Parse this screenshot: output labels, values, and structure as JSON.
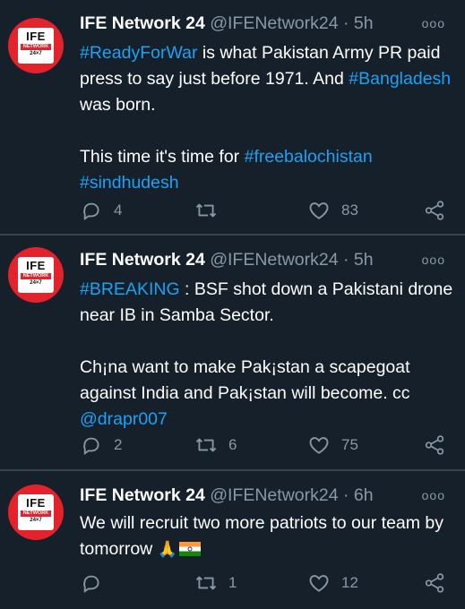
{
  "tweets": [
    {
      "name": "IFE Network 24",
      "handle": "@IFENetwork24",
      "sep": " · ",
      "time": "5h",
      "avatar": {
        "line1": "IFE",
        "line2": "NETWORK",
        "line3": "24×7"
      },
      "text": {
        "p1_tag1": "#ReadyForWar",
        "p1_mid": " is what Pakistan Army PR paid press to say just before 1971. And ",
        "p1_tag2": "#Bangladesh",
        "p1_end": " was born.",
        "p2_start": "This time it's time for ",
        "p2_tag1": "#freebalochistan",
        "p2_tag2": "#sindhudesh"
      },
      "replies": "4",
      "retweets": "",
      "likes": "83"
    },
    {
      "name": "IFE Network 24",
      "handle": "@IFENetwork24",
      "sep": " · ",
      "time": "5h",
      "avatar": {
        "line1": "IFE",
        "line2": "NETWORK",
        "line3": "24×7"
      },
      "text": {
        "p1_tag": "#BREAKING",
        "p1_rest": " : BSF shot down a Pakistani drone near IB in Samba Sector.",
        "p2_text": "Ch¡na want to make Pak¡stan a scapegoat against India and Pak¡stan will become. cc ",
        "p2_mention": "@drapr007"
      },
      "replies": "2",
      "retweets": "6",
      "likes": "75"
    },
    {
      "name": "IFE Network 24",
      "handle": "@IFENetwork24",
      "sep": " · ",
      "time": "6h",
      "avatar": {
        "line1": "IFE",
        "line2": "NETWORK",
        "line3": "24×7"
      },
      "text": {
        "p1_text": "We will recruit two more patriots to our team by tomorrow ",
        "emoji_pray": "🙏",
        "emoji_flag_name": "india-flag"
      },
      "replies": "",
      "retweets": "1",
      "likes": "12"
    }
  ],
  "more_glyph": "ooo",
  "colors": {
    "background": "#15202b",
    "link": "#1da1f2",
    "muted": "#8899a6",
    "divider": "#38444d",
    "avatar": "#e3222b"
  }
}
